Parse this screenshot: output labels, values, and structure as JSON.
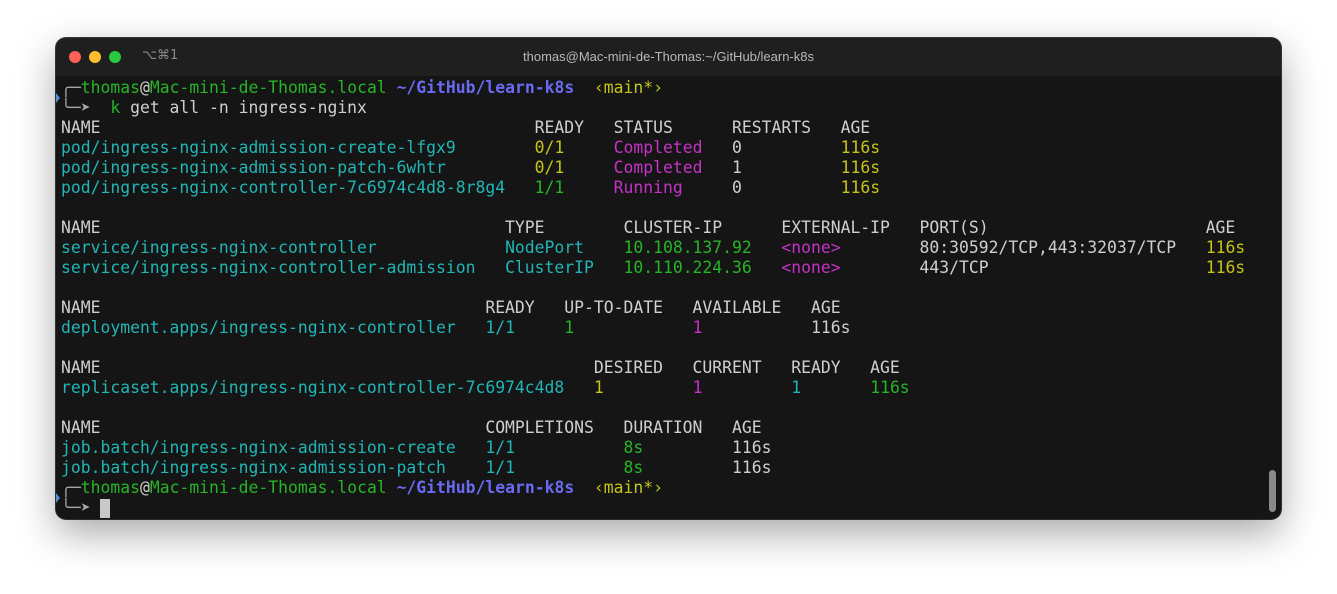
{
  "window": {
    "title": "thomas@Mac-mini-de-Thomas:~/GitHub/learn-k8s",
    "shortcut": "⌥⌘1",
    "traffic_lights": {
      "close": "#fe5f57",
      "minimize": "#febc2e",
      "zoom": "#28c840"
    }
  },
  "colors": {
    "default": "#cfcfcf",
    "cyan": "#22b5b5",
    "yellow": "#c6c418",
    "green": "#26b526",
    "magenta": "#c631c6",
    "blue": "#6a6af2",
    "dim": "#a8a8a8"
  },
  "lines": [
    [
      {
        "t": "╭─",
        "c": "dim"
      },
      {
        "t": "thomas",
        "c": "green"
      },
      {
        "t": "@",
        "c": "default"
      },
      {
        "t": "Mac-mini-de-Thomas.local",
        "c": "green"
      },
      {
        "t": " ",
        "c": "default"
      },
      {
        "t": "~/GitHub/learn-k8s",
        "c": "blue",
        "b": true
      },
      {
        "t": "  ",
        "c": "default"
      },
      {
        "t": "‹main*›",
        "c": "yellow"
      }
    ],
    [
      {
        "t": "╰─➤  ",
        "c": "dim"
      },
      {
        "t": "k",
        "c": "green"
      },
      {
        "t": " get all -n ingress-nginx",
        "c": "default"
      }
    ],
    [
      {
        "t": "NAME                                            READY   STATUS      RESTARTS   AGE",
        "c": "default"
      }
    ],
    [
      {
        "t": "pod/ingress-nginx-admission-create-lfgx9        ",
        "c": "cyan"
      },
      {
        "t": "0/1     ",
        "c": "yellow"
      },
      {
        "t": "Completed   ",
        "c": "magenta"
      },
      {
        "t": "0          ",
        "c": "default"
      },
      {
        "t": "116s",
        "c": "yellow"
      }
    ],
    [
      {
        "t": "pod/ingress-nginx-admission-patch-6whtr         ",
        "c": "cyan"
      },
      {
        "t": "0/1     ",
        "c": "yellow"
      },
      {
        "t": "Completed   ",
        "c": "magenta"
      },
      {
        "t": "1          ",
        "c": "default"
      },
      {
        "t": "116s",
        "c": "yellow"
      }
    ],
    [
      {
        "t": "pod/ingress-nginx-controller-7c6974c4d8-8r8g4   ",
        "c": "cyan"
      },
      {
        "t": "1/1     ",
        "c": "green"
      },
      {
        "t": "Running     ",
        "c": "magenta"
      },
      {
        "t": "0          ",
        "c": "default"
      },
      {
        "t": "116s",
        "c": "yellow"
      }
    ],
    [],
    [
      {
        "t": "NAME                                         TYPE        CLUSTER-IP      EXTERNAL-IP   PORT(S)                      AGE",
        "c": "default"
      }
    ],
    [
      {
        "t": "service/ingress-nginx-controller             ",
        "c": "cyan"
      },
      {
        "t": "NodePort    ",
        "c": "cyan"
      },
      {
        "t": "10.108.137.92   ",
        "c": "green"
      },
      {
        "t": "<none>        ",
        "c": "magenta"
      },
      {
        "t": "80:30592/TCP,443:32037/TCP   ",
        "c": "default"
      },
      {
        "t": "116s",
        "c": "yellow"
      }
    ],
    [
      {
        "t": "service/ingress-nginx-controller-admission   ",
        "c": "cyan"
      },
      {
        "t": "ClusterIP   ",
        "c": "cyan"
      },
      {
        "t": "10.110.224.36   ",
        "c": "green"
      },
      {
        "t": "<none>        ",
        "c": "magenta"
      },
      {
        "t": "443/TCP                      ",
        "c": "default"
      },
      {
        "t": "116s",
        "c": "yellow"
      }
    ],
    [],
    [
      {
        "t": "NAME                                       READY   UP-TO-DATE   AVAILABLE   AGE",
        "c": "default"
      }
    ],
    [
      {
        "t": "deployment.apps/ingress-nginx-controller   ",
        "c": "cyan"
      },
      {
        "t": "1/1     ",
        "c": "cyan"
      },
      {
        "t": "1            ",
        "c": "green"
      },
      {
        "t": "1           ",
        "c": "magenta"
      },
      {
        "t": "116s",
        "c": "default"
      }
    ],
    [],
    [
      {
        "t": "NAME                                                  DESIRED   CURRENT   READY   AGE",
        "c": "default"
      }
    ],
    [
      {
        "t": "replicaset.apps/ingress-nginx-controller-7c6974c4d8   ",
        "c": "cyan"
      },
      {
        "t": "1         ",
        "c": "yellow"
      },
      {
        "t": "1         ",
        "c": "magenta"
      },
      {
        "t": "1       ",
        "c": "cyan"
      },
      {
        "t": "116s",
        "c": "green"
      }
    ],
    [],
    [
      {
        "t": "NAME                                       COMPLETIONS   DURATION   AGE",
        "c": "default"
      }
    ],
    [
      {
        "t": "job.batch/ingress-nginx-admission-create   ",
        "c": "cyan"
      },
      {
        "t": "1/1           ",
        "c": "cyan"
      },
      {
        "t": "8s         ",
        "c": "green"
      },
      {
        "t": "116s",
        "c": "default"
      }
    ],
    [
      {
        "t": "job.batch/ingress-nginx-admission-patch    ",
        "c": "cyan"
      },
      {
        "t": "1/1           ",
        "c": "cyan"
      },
      {
        "t": "8s         ",
        "c": "green"
      },
      {
        "t": "116s",
        "c": "default"
      }
    ],
    [
      {
        "t": "╭─",
        "c": "dim"
      },
      {
        "t": "thomas",
        "c": "green"
      },
      {
        "t": "@",
        "c": "default"
      },
      {
        "t": "Mac-mini-de-Thomas.local",
        "c": "green"
      },
      {
        "t": " ",
        "c": "default"
      },
      {
        "t": "~/GitHub/learn-k8s",
        "c": "blue",
        "b": true
      },
      {
        "t": "  ",
        "c": "default"
      },
      {
        "t": "‹main*›",
        "c": "yellow"
      }
    ],
    [
      {
        "t": "╰─➤ ",
        "c": "dim"
      }
    ]
  ]
}
